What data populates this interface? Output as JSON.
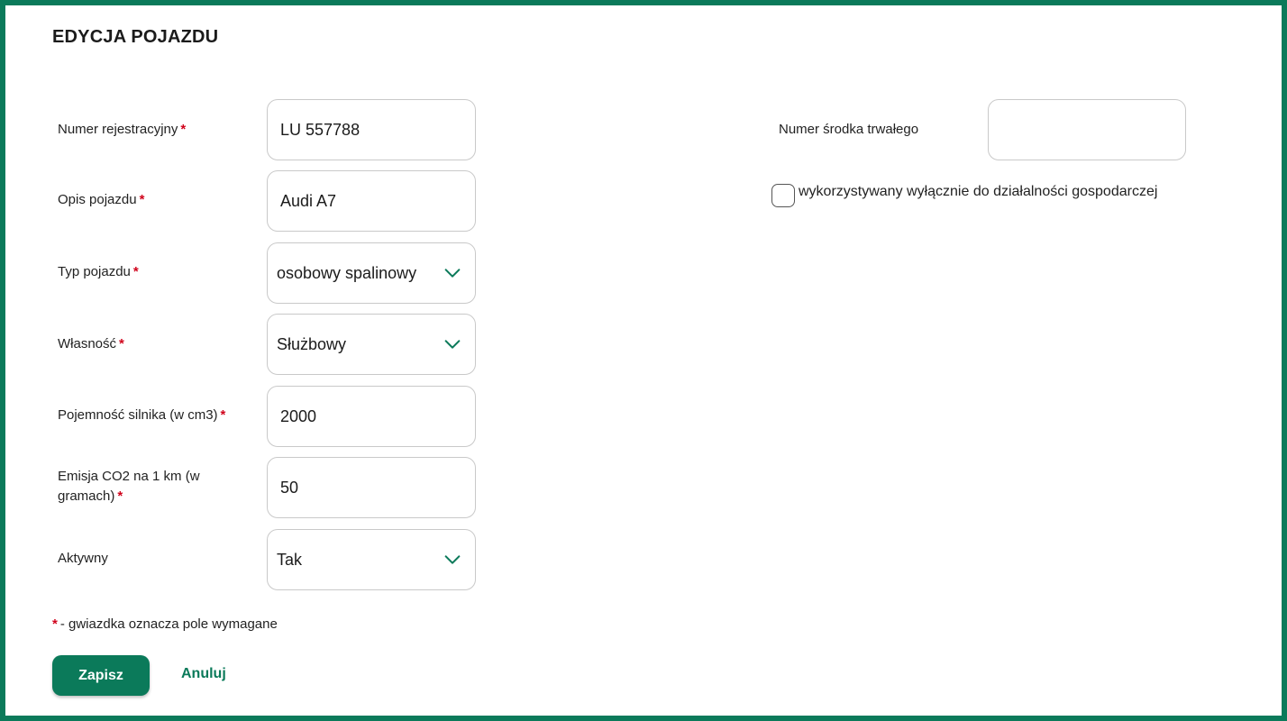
{
  "page": {
    "title": "EDYCJA POJAZDU"
  },
  "form": {
    "registration_number": {
      "label": "Numer rejestracyjny",
      "required_mark": "*",
      "value": "LU 557788"
    },
    "vehicle_description": {
      "label": "Opis pojazdu",
      "required_mark": "*",
      "value": "Audi A7"
    },
    "vehicle_type": {
      "label": "Typ pojazdu",
      "required_mark": "*",
      "selected": "osobowy spalinowy"
    },
    "ownership": {
      "label": "Własność",
      "required_mark": "*",
      "selected": "Służbowy"
    },
    "engine_capacity": {
      "label": "Pojemność silnika (w cm3)",
      "required_mark": "*",
      "value": "2000"
    },
    "co2_emission": {
      "label": "Emisja CO2 na 1 km (w gramach)",
      "required_mark": "*",
      "value": "50"
    },
    "active": {
      "label": "Aktywny",
      "selected": "Tak"
    },
    "fixed_asset_number": {
      "label": "Numer środka trwałego",
      "value": ""
    },
    "business_only": {
      "label": "wykorzystywany wyłącznie do działalności gospodarczej",
      "checked": false
    }
  },
  "legend": {
    "mark": "*",
    "text": "- gwiazdka oznacza pole wymagane"
  },
  "actions": {
    "save_label": "Zapisz",
    "cancel_label": "Anuluj"
  },
  "colors": {
    "accent": "#0b7a5a",
    "required": "#d0021b"
  }
}
